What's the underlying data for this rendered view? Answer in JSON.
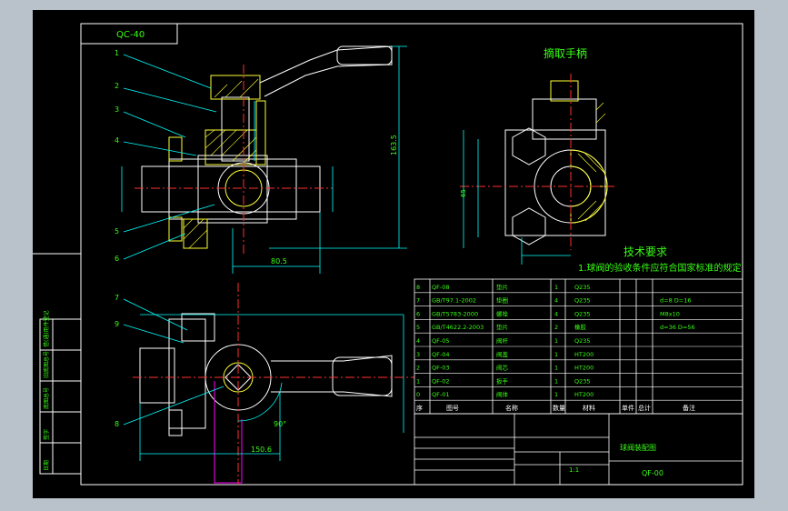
{
  "drawing": {
    "code_box": "QC-40",
    "view_title": "摘取手柄",
    "tech_title": "技术要求",
    "tech_note": "1.球阀的验收条件应符合国家标准的规定",
    "title_block": {
      "part_name": "球阀装配图",
      "drawing_no": "QF-00",
      "scale": "1:1"
    },
    "left_strip_labels": [
      "借(通)用件登记",
      "旧底图总号",
      "底图总号",
      "签字",
      "日期"
    ],
    "dimensions": {
      "top_length": "80.5",
      "bottom_length": "150.6",
      "angle": "90°",
      "right_height": "163.5",
      "right_height2": "65"
    },
    "leaders": [
      "1",
      "2",
      "3",
      "4",
      "5",
      "6",
      "7",
      "8",
      "9"
    ],
    "bom_header": [
      "序",
      "图号",
      "名称",
      "数量",
      "材料",
      "单件",
      "总计",
      "备注"
    ],
    "bom_rows": [
      {
        "no": "8",
        "code": "QF-08",
        "name": "垫片",
        "qty": "1",
        "material": "Q235",
        "note": ""
      },
      {
        "no": "7",
        "code": "GB/T97.1-2002",
        "name": "垫圈",
        "qty": "4",
        "material": "Q235",
        "note": "d=8 D=16"
      },
      {
        "no": "6",
        "code": "GB/T5783-2000",
        "name": "螺栓",
        "qty": "4",
        "material": "Q235",
        "note": "M8x10"
      },
      {
        "no": "5",
        "code": "GB/T4622.2-2003",
        "name": "垫片",
        "qty": "2",
        "material": "橡胶",
        "note": "d=36 D=56"
      },
      {
        "no": "4",
        "code": "QF-05",
        "name": "阀杆",
        "qty": "1",
        "material": "Q235",
        "note": ""
      },
      {
        "no": "3",
        "code": "QF-04",
        "name": "阀盖",
        "qty": "1",
        "material": "HT200",
        "note": ""
      },
      {
        "no": "2",
        "code": "QF-03",
        "name": "阀芯",
        "qty": "1",
        "material": "HT200",
        "note": ""
      },
      {
        "no": "1",
        "code": "QF-02",
        "name": "扳手",
        "qty": "1",
        "material": "Q235",
        "note": ""
      },
      {
        "no": "0",
        "code": "QF-01",
        "name": "阀体",
        "qty": "1",
        "material": "HT200",
        "note": ""
      }
    ],
    "colors": {
      "frame": "#ffffff",
      "line": "#ffffff",
      "dim": "#00ffff",
      "text": "#39ff14",
      "center": "#ff3030",
      "hatch": "#ffff33",
      "aux": "#ff00ff"
    }
  }
}
